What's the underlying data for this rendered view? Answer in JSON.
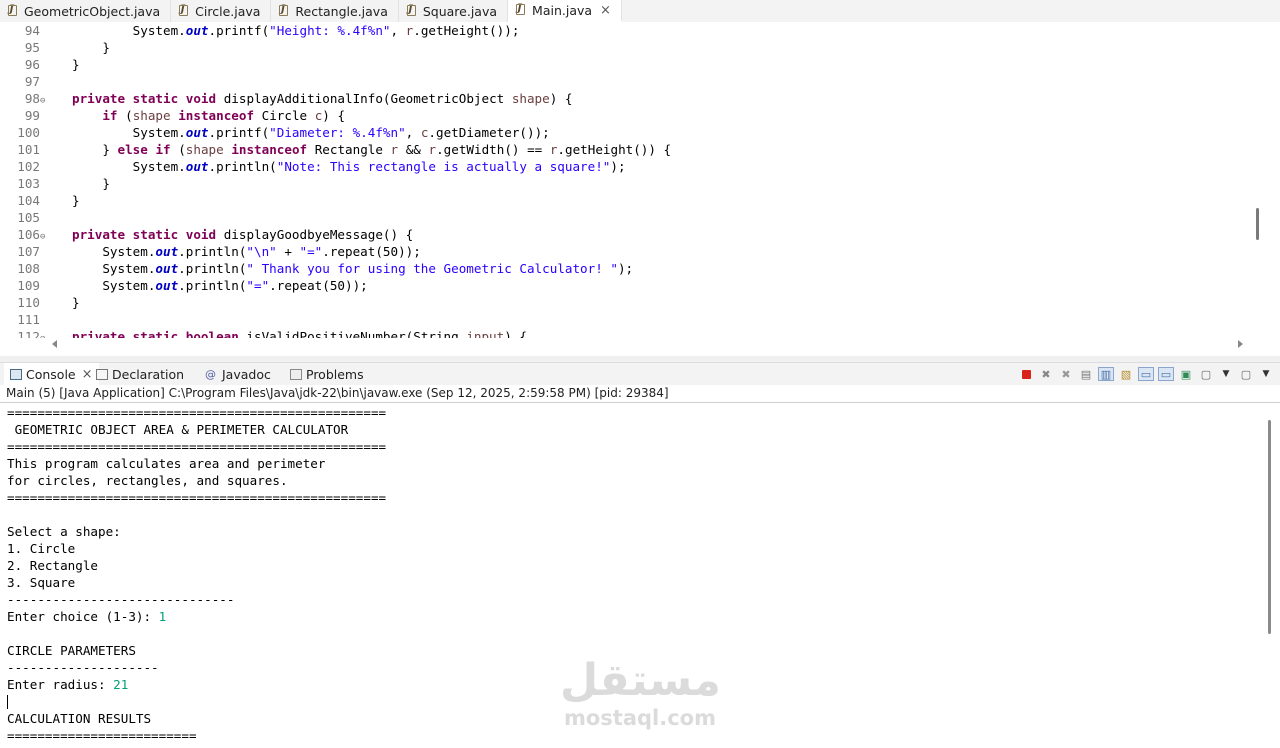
{
  "editor_tabs": [
    {
      "label": "GeometricObject.java"
    },
    {
      "label": "Circle.java"
    },
    {
      "label": "Rectangle.java"
    },
    {
      "label": "Square.java"
    },
    {
      "label": "Main.java",
      "close": "×"
    }
  ],
  "code_lines": [
    {
      "n": "94"
    },
    {
      "n": "95"
    },
    {
      "n": "96"
    },
    {
      "n": "97"
    },
    {
      "n": "98"
    },
    {
      "n": "99"
    },
    {
      "n": "100"
    },
    {
      "n": "101"
    },
    {
      "n": "102"
    },
    {
      "n": "103"
    },
    {
      "n": "104"
    },
    {
      "n": "105"
    },
    {
      "n": "106"
    },
    {
      "n": "107"
    },
    {
      "n": "108"
    },
    {
      "n": "109"
    },
    {
      "n": "110"
    },
    {
      "n": "111"
    },
    {
      "n": "112"
    }
  ],
  "code_text": {
    "l94": [
      "System.",
      "out",
      ".printf(",
      "\"Height: %.4f%n\"",
      ", ",
      "r",
      ".getHeight());"
    ],
    "l95": "}",
    "l96": "}",
    "l98": [
      "private",
      " ",
      "static",
      " ",
      "void",
      " displayAdditionalInfo(GeometricObject ",
      "shape",
      ") {"
    ],
    "l99": [
      "if",
      " (",
      "shape",
      " ",
      "instanceof",
      " Circle ",
      "c",
      ") {"
    ],
    "l100": [
      "System.",
      "out",
      ".printf(",
      "\"Diameter: %.4f%n\"",
      ", ",
      "c",
      ".getDiameter());"
    ],
    "l101": [
      "} ",
      "else",
      " ",
      "if",
      " (",
      "shape",
      " ",
      "instanceof",
      " Rectangle ",
      "r",
      " && ",
      "r",
      ".getWidth() == ",
      "r",
      ".getHeight()) {"
    ],
    "l102": [
      "System.",
      "out",
      ".println(",
      "\"Note: This rectangle is actually a square!\"",
      ");"
    ],
    "l103": "}",
    "l104": "}",
    "l106": [
      "private",
      " ",
      "static",
      " ",
      "void",
      " displayGoodbyeMessage() {"
    ],
    "l107": [
      "System.",
      "out",
      ".println(",
      "\"\\n\"",
      " + ",
      "\"=\"",
      ".repeat(50));"
    ],
    "l108": [
      "System.",
      "out",
      ".println(",
      "\" Thank you for using the Geometric Calculator! \"",
      ");"
    ],
    "l109": [
      "System.",
      "out",
      ".println(",
      "\"=\"",
      ".repeat(50));"
    ],
    "l110": "}",
    "l112": [
      "private",
      " ",
      "static",
      " ",
      "boolean",
      " isValidPositiveNumber(String ",
      "input",
      ") {"
    ]
  },
  "panel_tabs": {
    "console": "Console",
    "declaration": "Declaration",
    "javadoc": "Javadoc",
    "problems": "Problems",
    "close": "×"
  },
  "process_line": "Main (5) [Java Application] C:\\Program Files\\Java\\jdk-22\\bin\\javaw.exe  (Sep 12, 2025, 2:59:58 PM) [pid: 29384]",
  "console_lines": [
    {
      "text": "=================================================="
    },
    {
      "text": " GEOMETRIC OBJECT AREA & PERIMETER CALCULATOR"
    },
    {
      "text": "=================================================="
    },
    {
      "text": "This program calculates area and perimeter"
    },
    {
      "text": "for circles, rectangles, and squares."
    },
    {
      "text": "=================================================="
    },
    {
      "text": ""
    },
    {
      "text": "Select a shape:"
    },
    {
      "text": "1. Circle"
    },
    {
      "text": "2. Rectangle"
    },
    {
      "text": "3. Square"
    },
    {
      "text": "------------------------------"
    },
    {
      "text": "Enter choice (1-3): ",
      "input": "1"
    },
    {
      "text": ""
    },
    {
      "text": "CIRCLE PARAMETERS"
    },
    {
      "text": "--------------------"
    },
    {
      "text": "Enter radius: ",
      "input": "21"
    },
    {
      "text": ""
    },
    {
      "text": "CALCULATION RESULTS"
    },
    {
      "text": "========================="
    }
  ],
  "watermark": {
    "arabic": "مستقل",
    "latin": "mostaql.com"
  },
  "colors": {
    "keyword": "#7f0055",
    "string": "#2a00ff",
    "field": "#0000c0",
    "variable": "#6a3e3e",
    "user_input": "#00a07a"
  }
}
